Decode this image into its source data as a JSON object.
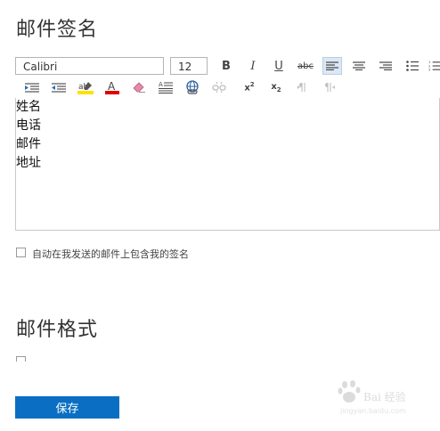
{
  "signature_section": {
    "title": "邮件签名"
  },
  "toolbar": {
    "font_name": "Calibri",
    "font_size": "12",
    "row1": [
      {
        "name": "bold-button",
        "icon": "bold-icon",
        "glyph": "B"
      },
      {
        "name": "italic-button",
        "icon": "italic-icon",
        "glyph": "I"
      },
      {
        "name": "underline-button",
        "icon": "underline-icon",
        "glyph": "U"
      },
      {
        "name": "strikethrough-button",
        "icon": "strikethrough-icon",
        "glyph": "abc"
      },
      {
        "name": "align-left-button",
        "icon": "align-left-icon"
      },
      {
        "name": "align-center-button",
        "icon": "align-center-icon"
      },
      {
        "name": "align-right-button",
        "icon": "align-right-icon"
      },
      {
        "name": "bullet-list-button",
        "icon": "bullet-list-icon"
      },
      {
        "name": "numbered-list-button",
        "icon": "numbered-list-icon"
      }
    ],
    "row2": [
      {
        "name": "increase-indent-button",
        "icon": "increase-indent-icon"
      },
      {
        "name": "decrease-indent-button",
        "icon": "decrease-indent-icon"
      },
      {
        "name": "highlight-button",
        "icon": "highlight-icon",
        "color": "#ffe100"
      },
      {
        "name": "font-color-button",
        "icon": "font-color-icon",
        "color": "#e00000"
      },
      {
        "name": "clear-format-button",
        "icon": "eraser-icon"
      },
      {
        "name": "line-spacing-button",
        "icon": "line-spacing-icon"
      },
      {
        "name": "insert-link-button",
        "icon": "link-icon"
      },
      {
        "name": "remove-link-button",
        "icon": "unlink-icon"
      },
      {
        "name": "superscript-button",
        "icon": "superscript-icon"
      },
      {
        "name": "subscript-button",
        "icon": "subscript-icon"
      },
      {
        "name": "ltr-button",
        "icon": "ltr-icon"
      },
      {
        "name": "rtl-button",
        "icon": "rtl-icon"
      }
    ],
    "active_color": "#dce8f5"
  },
  "editor": {
    "lines": [
      "姓名",
      "电话",
      "邮件",
      "地址"
    ]
  },
  "auto_signature": {
    "label": "自动在我发送的邮件上包含我的签名",
    "checked": false
  },
  "format_section": {
    "title": "邮件格式"
  },
  "save_button": {
    "label": "保存",
    "color": "#0a6fc2"
  },
  "watermark": {
    "text": "Bai 经验",
    "sub": "jingyan.baidu.com"
  }
}
